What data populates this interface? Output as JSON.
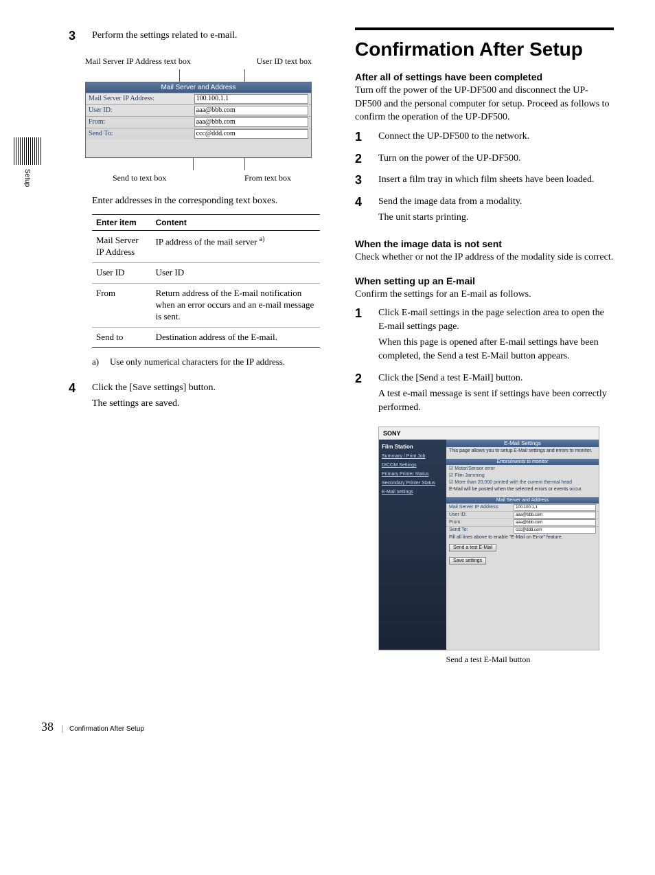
{
  "sideTab": "Setup",
  "left": {
    "step3": {
      "num": "3",
      "text": "Perform the settings related to e-mail."
    },
    "callouts": {
      "topLeft": "Mail Server IP Address text box",
      "topRight": "User ID text box",
      "botLeft": "Send to text box",
      "botRight": "From text box"
    },
    "dialog": {
      "header": "Mail Server and Address",
      "rows": [
        {
          "label": "Mail Server IP Address:",
          "value": "100.100.1.1"
        },
        {
          "label": "User ID:",
          "value": "aaa@bbb.com"
        },
        {
          "label": "From:",
          "value": "aaa@bbb.com"
        },
        {
          "label": "Send To:",
          "value": "ccc@ddd.com"
        }
      ]
    },
    "tableIntro": "Enter addresses in the corresponding text boxes.",
    "tableHeaders": {
      "c1": "Enter item",
      "c2": "Content"
    },
    "tableRows": [
      {
        "item": "Mail Server IP Address",
        "content": "IP address of the mail server",
        "sup": "a)"
      },
      {
        "item": "User ID",
        "content": "User ID",
        "sup": ""
      },
      {
        "item": "From",
        "content": "Return address of the E-mail notification when an error occurs and an e-mail message is sent.",
        "sup": ""
      },
      {
        "item": "Send to",
        "content": "Destination address of the E-mail.",
        "sup": ""
      }
    ],
    "footnote": {
      "key": "a)",
      "text": "Use only numerical characters for the IP address."
    },
    "step4": {
      "num": "4",
      "line1": "Click the [Save settings] button.",
      "line2": "The settings are saved."
    }
  },
  "right": {
    "title": "Confirmation After Setup",
    "sec1": {
      "heading": "After all of settings have been completed",
      "p": "Turn off the power of the UP-DF500 and disconnect the UP-DF500 and the personal computer for setup. Proceed as follows to confirm the operation of the UP-DF500."
    },
    "steps": [
      {
        "num": "1",
        "text": "Connect the UP-DF500 to the network."
      },
      {
        "num": "2",
        "text": "Turn on the power of the UP-DF500."
      },
      {
        "num": "3",
        "text": "Insert a film tray in which film sheets have been loaded."
      },
      {
        "num": "4",
        "text": "Send the image data from a modality.\nThe unit starts printing."
      }
    ],
    "sec2": {
      "heading": "When the image data is not sent",
      "p": "Check whether or not the IP address of the modality side is correct."
    },
    "sec3": {
      "heading": "When setting up an E-mail",
      "p": "Confirm the settings for an E-mail as follows."
    },
    "emailSteps": [
      {
        "num": "1",
        "text": "Click E-mail settings in the page selection area to open the E-mail settings page.\nWhen this page is opened after E-mail settings have been completed, the Send a test E-Mail button appears."
      },
      {
        "num": "2",
        "text": "Click the [Send a test E-Mail] button.\nA test e-mail message is sent if settings have been correctly performed."
      }
    ],
    "appShot": {
      "brand": "SONY",
      "sidebarTitle": "Film Station",
      "sidebarItems": [
        "Summary / Print Job",
        "DICOM Settings",
        "Primary Printer Status",
        "Secondary Printer Status",
        "E-Mail settings"
      ],
      "contentTitle": "E-Mail Settings",
      "contentSub": "This page allows you to setup E-Mail settings and errors to monitor.",
      "errorsHeader": "Errors/events to monitor",
      "chk1": "Motor/Sensor error",
      "chk2": "Film Jamming",
      "chk3": "More than 20,000 printed with the current thermal head",
      "chkNote": "E-Mail will be posted when the selected errors or events occur.",
      "mailHeader": "Mail Server and Address",
      "fields": [
        {
          "l": "Mail Server IP Address:",
          "v": "100.100.1.1"
        },
        {
          "l": "User ID:",
          "v": "aaa@bbb.com"
        },
        {
          "l": "From:",
          "v": "aaa@bbb.com"
        },
        {
          "l": "Send To:",
          "v": "ccc@ddd.com"
        }
      ],
      "fillNote": "Fill all lines above to enable \"E-Mail on Error\" feature.",
      "btn1": "Send a test E-Mail",
      "btn2": "Save settings"
    },
    "shotCaption": "Send a test E-Mail button"
  },
  "footer": {
    "pageNum": "38",
    "section": "Confirmation After Setup"
  }
}
